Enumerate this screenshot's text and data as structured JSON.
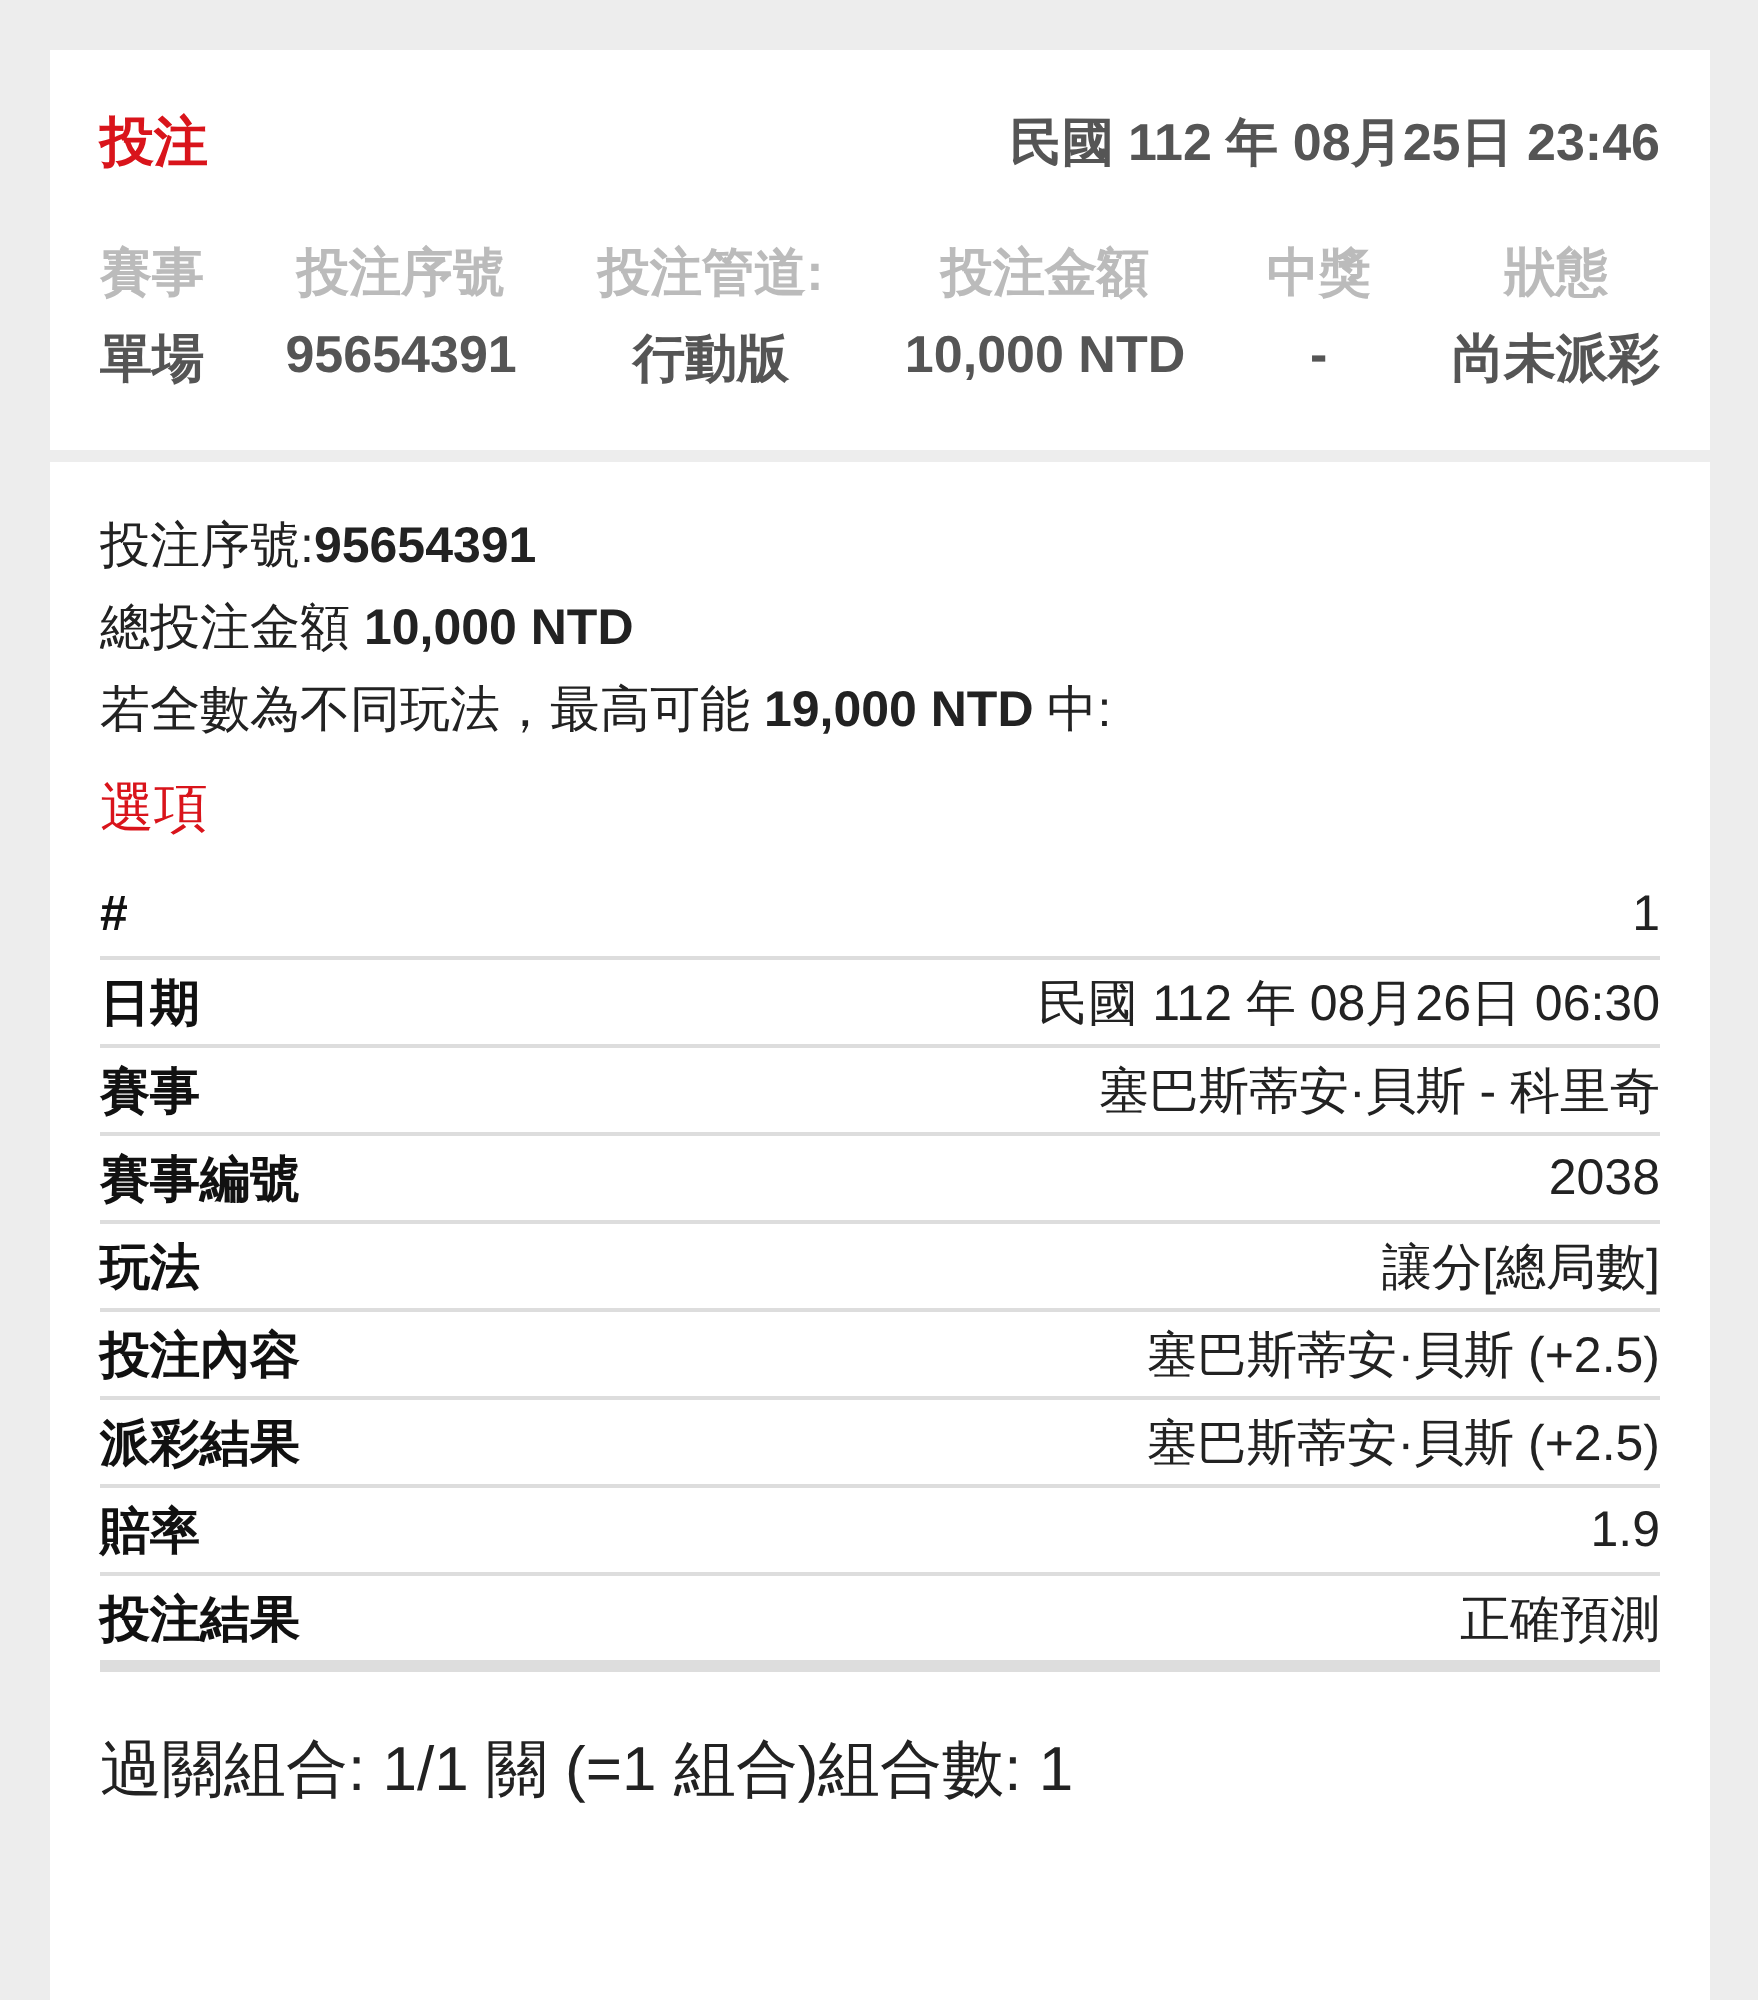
{
  "header": {
    "title": "投注",
    "datetime": "民國 112 年 08月25日 23:46"
  },
  "summary": {
    "columns": [
      "賽事",
      "投注序號",
      "投注管道:",
      "投注金額",
      "中獎",
      "狀態"
    ],
    "values": [
      "單場",
      "95654391",
      "行動版",
      "10,000 NTD",
      "-",
      "尚未派彩"
    ]
  },
  "details": [
    "投注序號:**95654391**",
    "總投注金額 **10,000 NTD**",
    "若全數為不同玩法，最高可能 **19,000 NTD** 中:"
  ],
  "options_title": "選項",
  "options": [
    {
      "label": "#",
      "value": "1"
    },
    {
      "label": "日期",
      "value": "民國 112 年 08月26日 06:30"
    },
    {
      "label": "賽事",
      "value": "塞巴斯蒂安·貝斯 - 科里奇"
    },
    {
      "label": "賽事編號",
      "value": "2038"
    },
    {
      "label": "玩法",
      "value": "讓分[總局數]"
    },
    {
      "label": "投注內容",
      "value": "塞巴斯蒂安·貝斯 (+2.5)"
    },
    {
      "label": "派彩結果",
      "value": "塞巴斯蒂安·貝斯 (+2.5)"
    },
    {
      "label": "賠率",
      "value": "1.9"
    },
    {
      "label": "投注結果",
      "value": "正確預測"
    }
  ],
  "combination": "過關組合: 1/1 關 (=1 組合)組合數: 1"
}
